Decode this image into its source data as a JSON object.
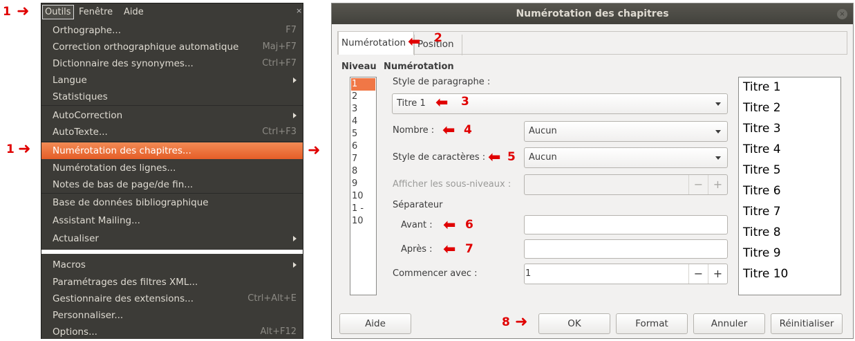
{
  "annotations": {
    "m1a": "1",
    "m1b": "1",
    "m2": "2",
    "m3": "3",
    "m4": "4",
    "m5": "5",
    "m6": "6",
    "m7": "7",
    "m8": "8"
  },
  "menubar": {
    "items": [
      "Outils",
      "Fenêtre",
      "Aide"
    ],
    "close_glyph": "×"
  },
  "menu": {
    "items": [
      {
        "label": "Orthographe...",
        "shortcut": "F7"
      },
      {
        "label": "Correction orthographique automatique",
        "shortcut": "Maj+F7"
      },
      {
        "label": "Dictionnaire des synonymes...",
        "shortcut": "Ctrl+F7"
      },
      {
        "label": "Langue",
        "submenu": true
      },
      {
        "label": "Statistiques"
      },
      {
        "label": "AutoCorrection",
        "submenu": true
      },
      {
        "label": "AutoTexte...",
        "shortcut": "Ctrl+F3"
      },
      {
        "label": "Numérotation des chapitres...",
        "active": true
      },
      {
        "label": "Numérotation des lignes..."
      },
      {
        "label": "Notes de bas de page/de fin..."
      },
      {
        "label": "Base de données bibliographique"
      },
      {
        "label": "Assistant Mailing..."
      },
      {
        "label": "Actualiser",
        "submenu": true
      },
      {
        "label": "Macros",
        "submenu": true
      },
      {
        "label": "Paramétrages des filtres XML..."
      },
      {
        "label": "Gestionnaire des extensions...",
        "shortcut": "Ctrl+Alt+E"
      },
      {
        "label": "Personnaliser..."
      },
      {
        "label": "Options...",
        "shortcut": "Alt+F12"
      }
    ]
  },
  "dialog": {
    "title": "Numérotation des chapitres",
    "close_glyph": "×",
    "tabs": [
      "Numérotation",
      "Position"
    ],
    "niveau_header": "Niveau",
    "numerotation_header": "Numérotation",
    "levels": [
      "1",
      "2",
      "3",
      "4",
      "5",
      "6",
      "7",
      "8",
      "9",
      "10",
      "1 - 10"
    ],
    "selected_level": "1",
    "style_paragraphe_label": "Style de paragraphe :",
    "style_paragraphe_value": "Titre 1",
    "nombre_label": "Nombre :",
    "nombre_value": "Aucun",
    "style_caracteres_label": "Style de caractères :",
    "style_caracteres_value": "Aucun",
    "sous_niveaux_label": "Afficher les sous-niveaux :",
    "sous_niveaux_value": "",
    "separateur_label": "Séparateur",
    "avant_label": "Avant :",
    "avant_value": "",
    "apres_label": "Après :",
    "apres_value": "",
    "commencer_label": "Commencer avec :",
    "commencer_value": "1",
    "minus": "−",
    "plus": "+",
    "preview": [
      "Titre 1",
      "Titre 2",
      "Titre 3",
      "Titre 4",
      "Titre 5",
      "Titre 6",
      "Titre 7",
      "Titre 8",
      "Titre 9",
      "Titre 10"
    ],
    "buttons": {
      "aide": "Aide",
      "ok": "OK",
      "format": "Format",
      "annuler": "Annuler",
      "reinitialiser": "Réinitialiser"
    }
  },
  "colors": {
    "accent": "#f07746",
    "menu_bg": "#3c3b37",
    "annotation": "#e00000"
  }
}
